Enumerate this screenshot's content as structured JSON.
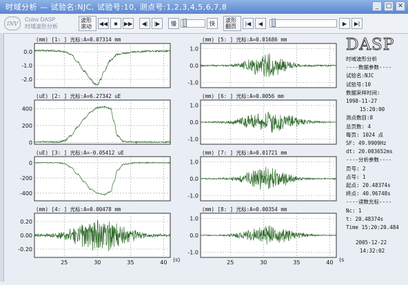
{
  "window": {
    "title": "时域分析 — 试验名:NJC, 试验号:10, 测点号:1,2,3,4,5,6,7,8",
    "min_icon": "minimize-icon",
    "max_icon": "maximize-icon",
    "close_icon": "close-icon"
  },
  "toolbar": {
    "logo_text": "INV",
    "app_name_1": "Coinv DASP",
    "app_name_2": "时域波形分析",
    "scroll_label": "波形滚动",
    "page_label": "波形翻页",
    "slow": "慢",
    "fast": "快",
    "nav_buttons": [
      "◀◀",
      "■",
      "▶▶",
      "◀|",
      "|▶"
    ],
    "page_buttons": [
      "|◀",
      "◀",
      "▶",
      "▶|"
    ]
  },
  "panel": {
    "logo": "DASP",
    "heading": "时域波形分析",
    "data_params": "----数据参数----",
    "test_name": "试验名:NJC",
    "test_no": "试验号:10",
    "sample_time_label": "数据采样时间:",
    "date": "1998-11-27",
    "time": "15:20:00",
    "channels": "测点数目:8",
    "pages": "总页数: 4",
    "points": "每页: 1024 点",
    "sf": "SF: 49.9909Hz",
    "dt": "dt: 20.003652ms",
    "analysis_params": "----分析参数----",
    "page_no": "页号: 2",
    "point_no": "点号: 1",
    "start": "起点: 20.48374s",
    "end": "终点: 40.96748s",
    "cursor_params": "----读数光标----",
    "nc": "Nc: 1",
    "t": "t: 20.48374s",
    "time_cursor": "Time 15:20:20.484",
    "footer_date": "2005-12-22",
    "footer_time": "14:32:02"
  },
  "chart_data": [
    {
      "type": "line",
      "title": "(mm) [1:  ] 光标:A=0.07314 mm",
      "ylim": [
        -2.6,
        0.6
      ],
      "yticks": [
        0,
        -1.0,
        -2.0
      ],
      "ytick_labels": [
        "0.0",
        "-1.0",
        "-2.0"
      ],
      "x": [
        20.5,
        22,
        24,
        25,
        26,
        27,
        28,
        29,
        29.5,
        30,
        30.5,
        31,
        32,
        33,
        34,
        36,
        38,
        41
      ],
      "y": [
        0.07,
        0.1,
        0.05,
        0,
        -0.2,
        -0.7,
        -1.4,
        -2.0,
        -2.3,
        -2.4,
        -2.0,
        -1.4,
        -0.6,
        -0.2,
        -0.1,
        0,
        0.05,
        0.05
      ],
      "noise": 0.06
    },
    {
      "type": "line",
      "title": "(uE) [2:  ] 光标:A=6.27342 uE",
      "ylim": [
        -20,
        500
      ],
      "yticks": [
        400,
        200,
        0
      ],
      "ytick_labels": [
        "400",
        "200",
        "0"
      ],
      "x": [
        20.5,
        22,
        24,
        25,
        26,
        27,
        28,
        29,
        30,
        31,
        32,
        32.5,
        33,
        34,
        36,
        38,
        41
      ],
      "y": [
        6,
        10,
        5,
        20,
        80,
        180,
        280,
        360,
        410,
        420,
        400,
        250,
        80,
        10,
        5,
        5,
        5
      ],
      "noise": 8
    },
    {
      "type": "line",
      "title": "(uE) [3:  ] 光标:A=-0.05412 uE",
      "ylim": [
        -500,
        80
      ],
      "yticks": [
        0,
        -200,
        -400
      ],
      "ytick_labels": [
        "0",
        "-200",
        "-400"
      ],
      "x": [
        20.5,
        24,
        25,
        26,
        27,
        28,
        29,
        30,
        31,
        32,
        32.5,
        33,
        34,
        36,
        41
      ],
      "y": [
        -0.05,
        0,
        -10,
        -60,
        -150,
        -250,
        -350,
        -400,
        -420,
        -380,
        -250,
        -100,
        -20,
        0,
        0
      ],
      "noise": 6
    },
    {
      "type": "line",
      "title": "(mm) [4:  ] 光标:A=0.00478 mm",
      "ylim": [
        -0.32,
        0.32
      ],
      "yticks": [
        0.2,
        0,
        -0.2
      ],
      "ytick_labels": [
        "0.20",
        "0.00",
        "-0.20"
      ],
      "osc": {
        "center": 30.5,
        "width": 4.5,
        "amp": 0.17,
        "base": 0.015,
        "seed": 4
      }
    },
    {
      "type": "line",
      "title": "(mm) [5:  ] 光标:A=0.01686 mm",
      "ylim": [
        -1.3,
        1.3
      ],
      "yticks": [
        1.0,
        0,
        -1.0
      ],
      "ytick_labels": [
        "1.0",
        "0.0",
        "-1.0"
      ],
      "osc": {
        "center": 30.5,
        "width": 3.0,
        "amp": 0.55,
        "base": 0.04,
        "seed": 5
      }
    },
    {
      "type": "line",
      "title": "(mm) [6:  ] 光标:A=0.0056 mm",
      "ylim": [
        -1.3,
        1.3
      ],
      "yticks": [
        1.0,
        0,
        -1.0
      ],
      "ytick_labels": [
        "1.0",
        "0.0",
        "-1.0"
      ],
      "osc": {
        "center": 31,
        "width": 4.5,
        "amp": 0.45,
        "base": 0.02,
        "seed": 6
      }
    },
    {
      "type": "line",
      "title": "(mm) [7:  ] 光标:A=0.01721 mm",
      "ylim": [
        -1.3,
        1.3
      ],
      "yticks": [
        1.0,
        0,
        -1.0
      ],
      "ytick_labels": [
        "1.0",
        "0.0",
        "-1.0"
      ],
      "osc": {
        "center": 30.5,
        "width": 3.5,
        "amp": 0.5,
        "base": 0.03,
        "seed": 7
      }
    },
    {
      "type": "line",
      "title": "(mm) [8:  ] 光标:A=0.00354 mm",
      "ylim": [
        -1.3,
        1.3
      ],
      "yticks": [
        1.0,
        0,
        -1.0
      ],
      "ytick_labels": [
        "1.0",
        "0.0",
        "-1.0"
      ],
      "osc": {
        "center": 31,
        "width": 4.0,
        "amp": 0.4,
        "base": 0.02,
        "seed": 8
      }
    }
  ],
  "xaxis": {
    "xlim": [
      20.5,
      41
    ],
    "ticks": [
      25,
      30,
      35,
      40
    ],
    "unit": "(s)"
  },
  "colors": {
    "trace": "#2f6b2a",
    "grid": "#9aa3ac",
    "frame": "#333333"
  }
}
